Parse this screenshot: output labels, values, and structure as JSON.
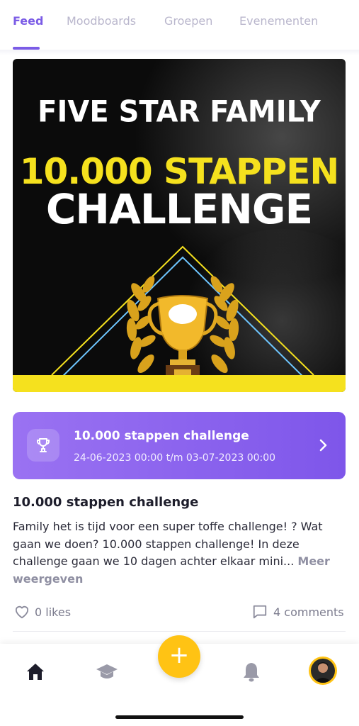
{
  "tabs": [
    {
      "label": "Feed",
      "active": true
    },
    {
      "label": "Moodboards",
      "active": false
    },
    {
      "label": "Groepen",
      "active": false
    },
    {
      "label": "Evenementen",
      "active": false
    }
  ],
  "banner": {
    "line_top": "FIVE STAR FAMILY",
    "line_yellow": "10.000 STAPPEN",
    "line_white": "CHALLENGE",
    "colors": {
      "yellow": "#f5e11e",
      "background": "#0b0b0b",
      "blue_line": "#6ec6ff"
    }
  },
  "event": {
    "icon": "trophy-icon",
    "title": "10.000 stappen challenge",
    "date_range": "24-06-2023 00:00 t/m 03-07-2023 00:00",
    "chevron": "chevron-right-icon",
    "color": "#8a63ee"
  },
  "post": {
    "title": "10.000 stappen challenge",
    "body": "Family het is tijd voor een super toffe challenge! ? Wat gaan we doen? 10.000 stappen challenge! In deze challenge gaan we 10 dagen achter elkaar mini...",
    "more_label": "Meer weergeven",
    "likes": "0 likes",
    "comments": "4 comments"
  },
  "bottom_nav": {
    "items": [
      "home-icon",
      "graduation-cap-icon",
      "add-icon",
      "bell-icon",
      "avatar"
    ],
    "fab_label": "+",
    "fab_color": "#ffc314"
  }
}
